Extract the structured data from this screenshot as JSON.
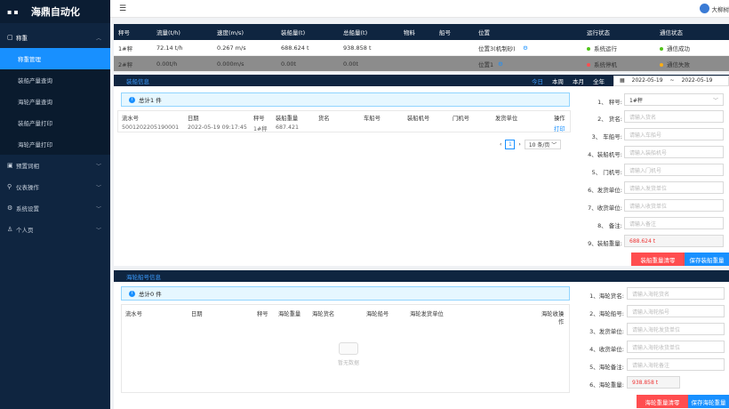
{
  "app": {
    "title": "海鼎自动化",
    "user": "大柳树"
  },
  "sidebar": {
    "items": [
      {
        "label": "称重",
        "open": true
      },
      {
        "label": "称重管理",
        "sub": true,
        "active": true
      },
      {
        "label": "装船产量查询",
        "sub": true
      },
      {
        "label": "海轮产量查询",
        "sub": true
      },
      {
        "label": "装船产量打印",
        "sub": true
      },
      {
        "label": "海轮产量打印",
        "sub": true
      },
      {
        "label": "预置词相"
      },
      {
        "label": "仪表操作"
      },
      {
        "label": "系统设置"
      },
      {
        "label": "个人页"
      }
    ]
  },
  "scale_table": {
    "headers": [
      "秤号",
      "流量(t/h)",
      "速度(m/s)",
      "装船量(t)",
      "总船量(t)",
      "物料",
      "船号",
      "位置",
      "运行状态",
      "通信状态"
    ],
    "rows": [
      {
        "scale": "1#秤",
        "flow": "72.14 t/h",
        "speed": "0.267 m/s",
        "load": "688.624 t",
        "total": "938.858 t",
        "material": "",
        "ship": "",
        "position": "位置3(机制砂)",
        "run": "系统运行",
        "comm": "通信成功",
        "run_color": "#52c41a",
        "comm_color": "#52c41a"
      },
      {
        "scale": "2#秤",
        "flow": "0.00t/h",
        "speed": "0.000m/s",
        "load": "0.00t",
        "total": "0.00t",
        "material": "",
        "ship": "",
        "position": "位置1",
        "run": "系统停机",
        "comm": "通信失败",
        "run_color": "#ff4d4f",
        "comm_color": "#faad14"
      }
    ]
  },
  "panel1": {
    "tab": "装船信息",
    "filters": [
      "今日",
      "本周",
      "本月",
      "全年"
    ],
    "date_from": "2022-05-19",
    "date_sep": "~",
    "date_to": "2022-05-19",
    "summary": "总计1 件",
    "headers": [
      "流水号",
      "日期",
      "秤号",
      "装船重量",
      "货名",
      "车船号",
      "装船机号",
      "门机号",
      "发货单位",
      "操作"
    ],
    "rows": [
      {
        "serial": "5001202205190001",
        "date": "2022-05-19 09:17:45",
        "scale": "1#秤",
        "weight": "687.421",
        "action": "打印"
      }
    ],
    "pager": {
      "page": "1",
      "size": "10 条/页"
    },
    "form": [
      {
        "label": "1、    秤号:",
        "value": "1#秤",
        "placeholder": ""
      },
      {
        "label": "2、    货名:",
        "value": "",
        "placeholder": "请输入货名"
      },
      {
        "label": "3、  车船号:",
        "value": "",
        "placeholder": "请输入车船号"
      },
      {
        "label": "4、装船机号:",
        "value": "",
        "placeholder": "请输入装船机号"
      },
      {
        "label": "5、  门机号:",
        "value": "",
        "placeholder": "请输入门机号"
      },
      {
        "label": "6、发货单位:",
        "value": "",
        "placeholder": "请输入发货单位"
      },
      {
        "label": "7、收货单位:",
        "value": "",
        "placeholder": "请输入收货单位"
      },
      {
        "label": "8、    备注:",
        "value": "",
        "placeholder": "请输入备注"
      },
      {
        "label": "9、装船重量:",
        "value": "688.624 t",
        "placeholder": ""
      }
    ],
    "btn_clear": "装船重量清零",
    "btn_save": "保存装船重量"
  },
  "panel2": {
    "tab": "海轮船号信息",
    "summary": "总计0 件",
    "headers": [
      "流水号",
      "日期",
      "秤号",
      "海轮重量",
      "海轮货名",
      "海轮船号",
      "海轮发货单位",
      "海轮收",
      "操作"
    ],
    "empty": "暂无数据",
    "form": [
      {
        "label": "1、海轮货名:",
        "placeholder": "请输入海轮货名"
      },
      {
        "label": "2、海轮船号:",
        "placeholder": "请输入海轮船号"
      },
      {
        "label": "3、发货单位:",
        "placeholder": "请输入海轮发货单位"
      },
      {
        "label": "4、收货单位:",
        "placeholder": "请输入海轮收货单位"
      },
      {
        "label": "5、海轮备注:",
        "placeholder": "请输入海轮备注"
      },
      {
        "label": "6、海轮重量:",
        "value": "938.858 t"
      }
    ],
    "btn_clear": "海轮重量清零",
    "btn_save": "保存海轮重量"
  }
}
